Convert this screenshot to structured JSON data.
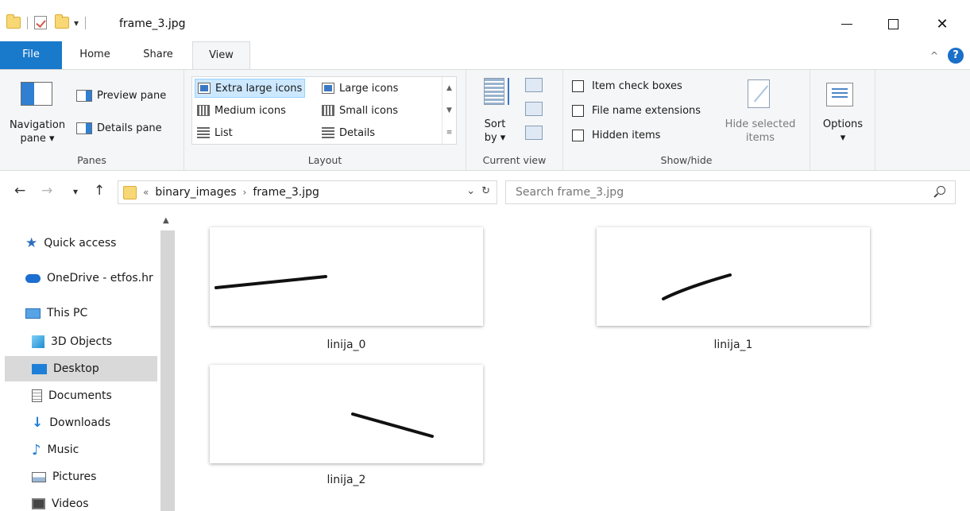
{
  "window": {
    "title": "frame_3.jpg"
  },
  "ribbon_tabs": {
    "file": "File",
    "home": "Home",
    "share": "Share",
    "view": "View"
  },
  "panes": {
    "navigation_pane": "Navigation",
    "navigation_pane2": "pane ▾",
    "preview_pane": "Preview pane",
    "details_pane": "Details pane",
    "group_label": "Panes"
  },
  "layout": {
    "extra_large": "Extra large icons",
    "large": "Large icons",
    "medium": "Medium icons",
    "small": "Small icons",
    "list": "List",
    "details": "Details",
    "group_label": "Layout"
  },
  "current_view": {
    "sort_by": "Sort",
    "sort_by2": "by ▾",
    "group_label": "Current view"
  },
  "show_hide": {
    "item_check_boxes": "Item check boxes",
    "file_name_extensions": "File name extensions",
    "hidden_items": "Hidden items",
    "hide_selected": "Hide selected",
    "hide_selected2": "items",
    "group_label": "Show/hide"
  },
  "options": {
    "label": "Options",
    "arrow": "▾"
  },
  "address": {
    "overflow": "«",
    "crumb_1": "binary_images",
    "separator": "›",
    "crumb_2": "frame_3.jpg",
    "search_placeholder": "Search frame_3.jpg"
  },
  "sidebar": {
    "quick_access": "Quick access",
    "onedrive": "OneDrive - etfos.hr",
    "this_pc": "This PC",
    "objects_3d": "3D Objects",
    "desktop": "Desktop",
    "documents": "Documents",
    "downloads": "Downloads",
    "music": "Music",
    "pictures": "Pictures",
    "videos": "Videos"
  },
  "files": [
    {
      "name": "linija_0"
    },
    {
      "name": "linija_1"
    },
    {
      "name": "linija_2"
    }
  ],
  "colors": {
    "accent": "#1979ca",
    "selected_view": "#cce8ff",
    "sidebar_selected": "#d9d9d9"
  }
}
